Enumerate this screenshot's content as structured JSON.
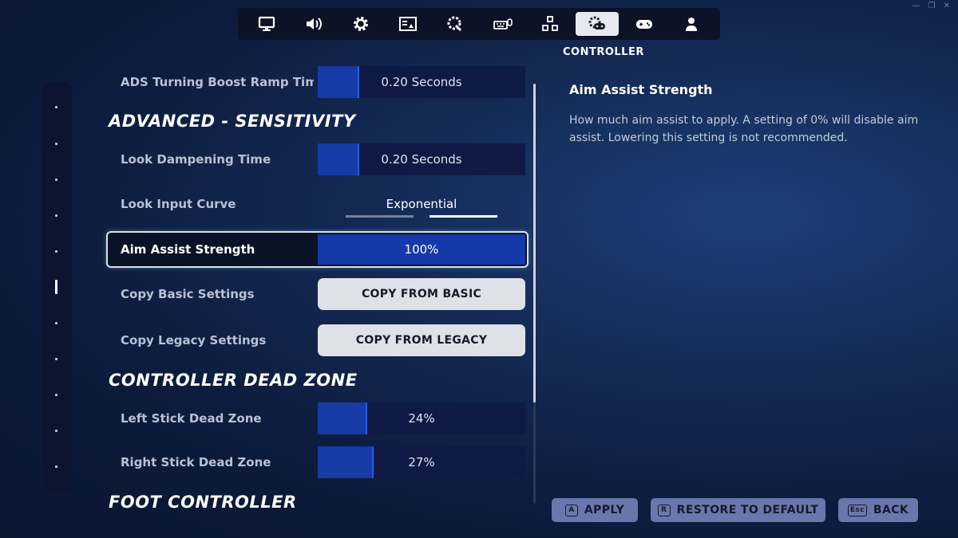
{
  "window_controls": [
    "—",
    "❐",
    "✕"
  ],
  "nav": {
    "tabs": [
      {
        "icon": "monitor-icon",
        "active": false
      },
      {
        "icon": "speaker-icon",
        "active": false
      },
      {
        "icon": "gear-icon",
        "active": false
      },
      {
        "icon": "hud-icon",
        "active": false
      },
      {
        "icon": "gear-touch-icon",
        "active": false
      },
      {
        "icon": "keyboard-mouse-icon",
        "active": false
      },
      {
        "icon": "touch-layout-icon",
        "active": false
      },
      {
        "icon": "controller-gear-icon",
        "active": true
      },
      {
        "icon": "gamepad-icon",
        "active": false
      },
      {
        "icon": "account-icon",
        "active": false
      }
    ],
    "active_caption": "CONTROLLER"
  },
  "settings": {
    "ads_ramp": {
      "label": "ADS Turning Boost Ramp Time",
      "value": "0.20 Seconds",
      "fill_fraction": 0.2
    },
    "section_advanced": "ADVANCED - SENSITIVITY",
    "look_dampening": {
      "label": "Look Dampening Time",
      "value": "0.20 Seconds",
      "fill_fraction": 0.2
    },
    "look_input_curve": {
      "label": "Look Input Curve",
      "value": "Exponential",
      "option_index": 2,
      "option_count": 2
    },
    "aim_assist": {
      "label": "Aim Assist Strength",
      "value": "100%",
      "fill_fraction": 1.0
    },
    "copy_basic": {
      "label": "Copy Basic Settings",
      "button": "COPY FROM BASIC"
    },
    "copy_legacy": {
      "label": "Copy Legacy Settings",
      "button": "COPY FROM LEGACY"
    },
    "section_deadzone": "CONTROLLER DEAD ZONE",
    "left_stick": {
      "label": "Left Stick Dead Zone",
      "value": "24%",
      "fill_fraction": 0.24
    },
    "right_stick": {
      "label": "Right Stick Dead Zone",
      "value": "27%",
      "fill_fraction": 0.27
    },
    "section_foot": "FOOT CONTROLLER"
  },
  "description": {
    "title": "Aim Assist Strength",
    "body": "How much aim assist to apply.  A setting of 0% will disable aim assist.  Lowering this setting is not recommended."
  },
  "footer": {
    "apply": {
      "key": "A",
      "label": "APPLY"
    },
    "restore": {
      "key": "R",
      "label": "RESTORE TO DEFAULT"
    },
    "back": {
      "key": "Esc",
      "label": "BACK"
    }
  },
  "colors": {
    "accent_fill": "#163aa6",
    "slider_track": "#0f1a44",
    "selection_border": "#cfe6e8",
    "footer_button": "#6b76ad"
  }
}
